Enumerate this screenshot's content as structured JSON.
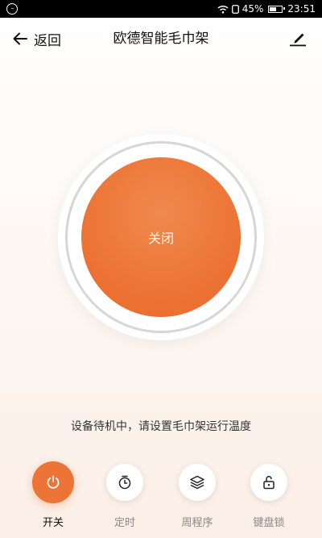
{
  "status_bar": {
    "battery": "45%",
    "time": "23:51"
  },
  "header": {
    "back_label": "返回",
    "title": "欧德智能毛巾架"
  },
  "dial": {
    "state_label": "关闭",
    "accent_color": "#ec7436"
  },
  "message": "设备待机中，请设置毛巾架运行温度",
  "controls": [
    {
      "label": "开关",
      "icon": "power-icon",
      "active": true
    },
    {
      "label": "定时",
      "icon": "timer-icon",
      "active": false
    },
    {
      "label": "周程序",
      "icon": "layers-icon",
      "active": false
    },
    {
      "label": "键盘锁",
      "icon": "unlock-icon",
      "active": false
    }
  ]
}
